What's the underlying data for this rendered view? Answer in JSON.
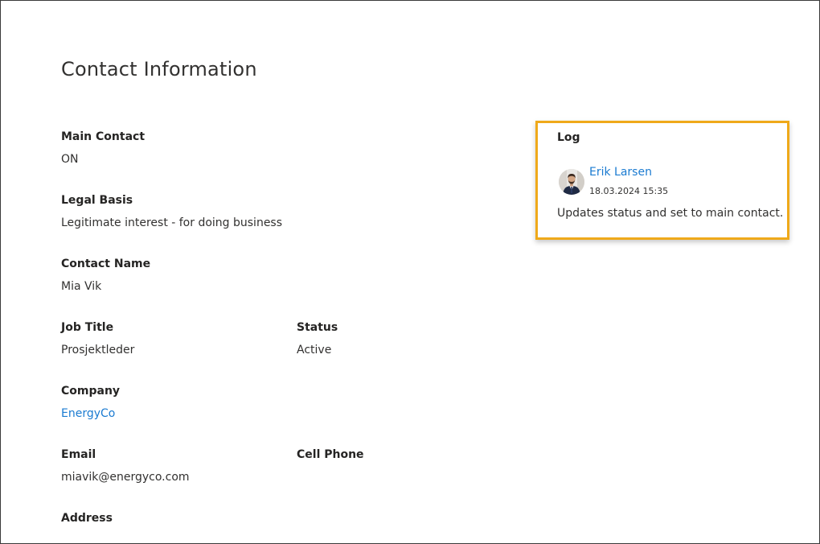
{
  "page": {
    "title": "Contact Information"
  },
  "fields": {
    "main_contact": {
      "label": "Main Contact",
      "value": "ON"
    },
    "legal_basis": {
      "label": "Legal Basis",
      "value": "Legitimate interest - for doing business"
    },
    "contact_name": {
      "label": "Contact Name",
      "value": "Mia Vik"
    },
    "job_title": {
      "label": "Job Title",
      "value": "Prosjektleder"
    },
    "status": {
      "label": "Status",
      "value": "Active"
    },
    "company": {
      "label": "Company",
      "value": "EnergyCo"
    },
    "email": {
      "label": "Email",
      "value": "miavik@energyco.com"
    },
    "cell_phone": {
      "label": "Cell Phone",
      "value": ""
    },
    "address": {
      "label": "Address",
      "value": ""
    }
  },
  "log": {
    "title": "Log",
    "entries": [
      {
        "author": "Erik Larsen",
        "timestamp": "18.03.2024 15:35",
        "text": "Updates status and set to main contact."
      }
    ]
  },
  "colors": {
    "link": "#1b7bd1",
    "highlight_border": "#efa91a",
    "text": "#323130"
  },
  "icons": {
    "avatar": "user-avatar"
  }
}
